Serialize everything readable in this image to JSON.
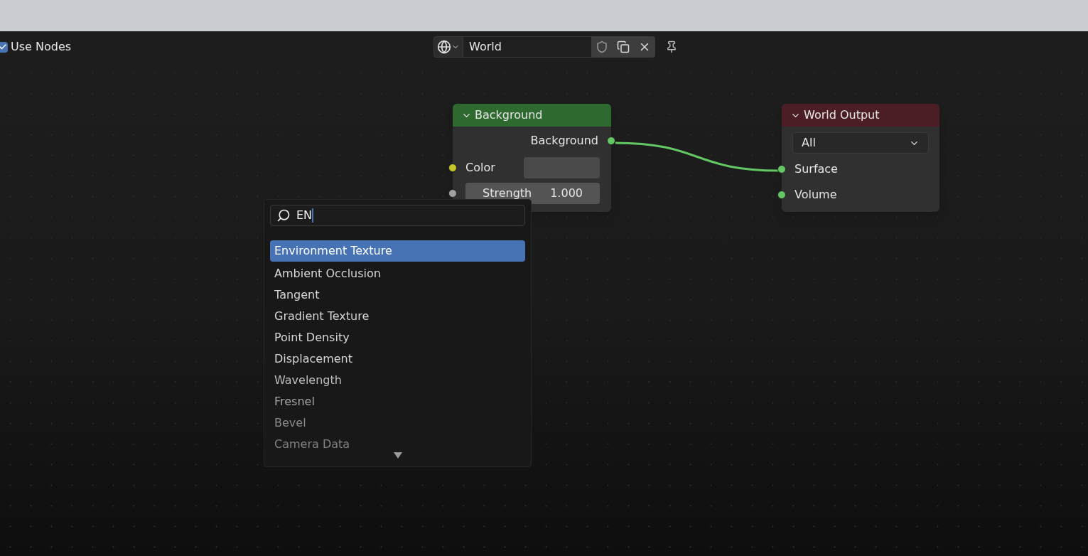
{
  "header": {
    "use_nodes": {
      "label": "Use Nodes",
      "checked": true
    },
    "world_selector": {
      "value": "World"
    }
  },
  "nodes": [
    {
      "kind": "background",
      "title": "Background",
      "outputs": [
        {
          "label": "Background",
          "color": "#63c763"
        }
      ],
      "inputs": [
        {
          "kind": "color",
          "label": "Color",
          "color": "#c7c729"
        },
        {
          "kind": "number",
          "label": "Strength",
          "value": "1.000",
          "color": "#a1a1a1"
        }
      ]
    },
    {
      "kind": "output",
      "title": "World Output",
      "target": "All",
      "inputs": [
        {
          "label": "Surface",
          "color": "#63c763"
        },
        {
          "label": "Volume",
          "color": "#63c763"
        }
      ]
    }
  ],
  "search_menu": {
    "query": "EN",
    "items": [
      {
        "label": "Environment Texture",
        "selected": true
      },
      {
        "label": "Ambient Occlusion",
        "selected": false
      },
      {
        "label": "Tangent",
        "selected": false
      },
      {
        "label": "Gradient Texture",
        "selected": false
      },
      {
        "label": "Point Density",
        "selected": false
      },
      {
        "label": "Displacement",
        "selected": false
      },
      {
        "label": "Wavelength",
        "selected": false
      },
      {
        "label": "Fresnel",
        "selected": false
      },
      {
        "label": "Bevel",
        "selected": false
      },
      {
        "label": "Camera Data",
        "selected": false
      }
    ]
  }
}
